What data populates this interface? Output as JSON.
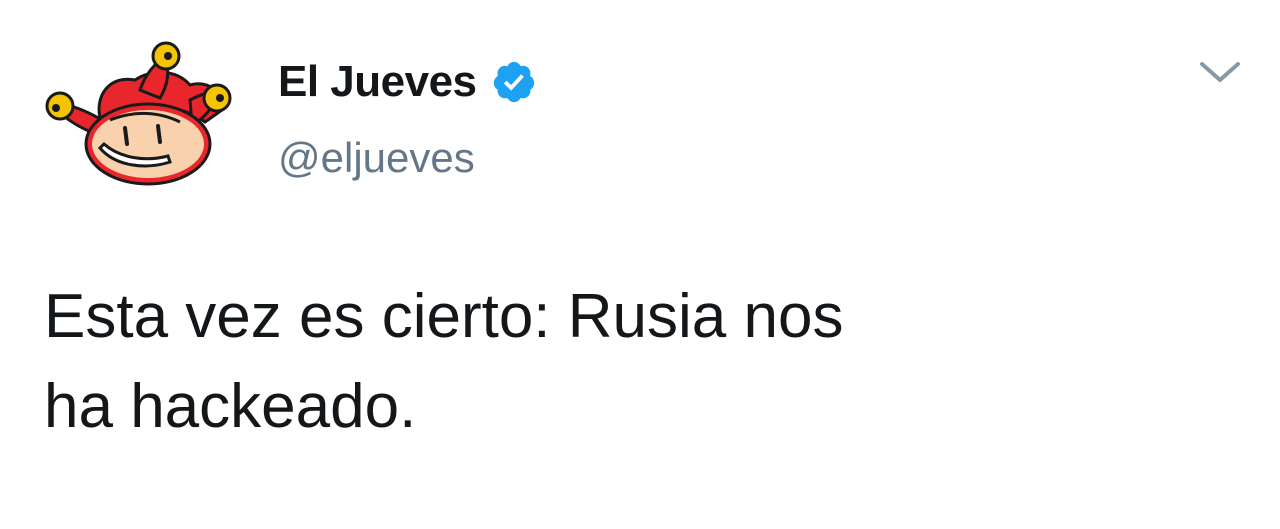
{
  "tweet": {
    "author": {
      "display_name": "El Jueves",
      "handle": "@eljueves",
      "verified": true,
      "avatar_icon": "jester-logo-icon",
      "verified_icon": "verified-badge-icon"
    },
    "menu_icon": "chevron-down-icon",
    "text_lines": [
      "Esta vez es cierto: Rusia nos",
      "ha hackeado."
    ]
  },
  "colors": {
    "text": "#14171a",
    "handle": "#657786",
    "verified": "#1da1f2",
    "caret": "#8899a6",
    "jester_red": "#e8262b",
    "jester_yellow": "#f5c400",
    "jester_skin": "#f9d2ad"
  }
}
